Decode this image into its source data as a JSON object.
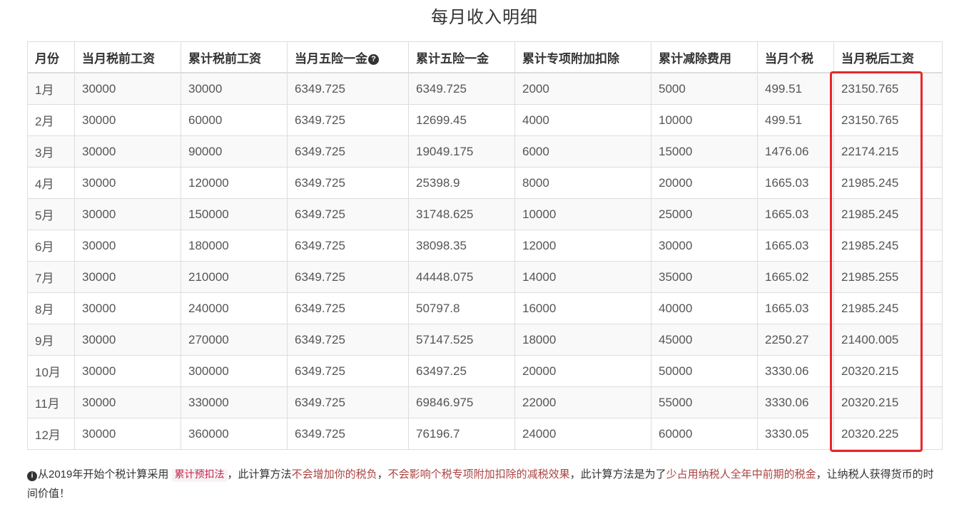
{
  "title": "每月收入明细",
  "table": {
    "headers": [
      "月份",
      "当月税前工资",
      "累计税前工资",
      "当月五险一金",
      "累计五险一金",
      "累计专项附加扣除",
      "累计减除费用",
      "当月个税",
      "当月税后工资"
    ],
    "rows": [
      [
        "1月",
        "30000",
        "30000",
        "6349.725",
        "6349.725",
        "2000",
        "5000",
        "499.51",
        "23150.765"
      ],
      [
        "2月",
        "30000",
        "60000",
        "6349.725",
        "12699.45",
        "4000",
        "10000",
        "499.51",
        "23150.765"
      ],
      [
        "3月",
        "30000",
        "90000",
        "6349.725",
        "19049.175",
        "6000",
        "15000",
        "1476.06",
        "22174.215"
      ],
      [
        "4月",
        "30000",
        "120000",
        "6349.725",
        "25398.9",
        "8000",
        "20000",
        "1665.03",
        "21985.245"
      ],
      [
        "5月",
        "30000",
        "150000",
        "6349.725",
        "31748.625",
        "10000",
        "25000",
        "1665.03",
        "21985.245"
      ],
      [
        "6月",
        "30000",
        "180000",
        "6349.725",
        "38098.35",
        "12000",
        "30000",
        "1665.03",
        "21985.245"
      ],
      [
        "7月",
        "30000",
        "210000",
        "6349.725",
        "44448.075",
        "14000",
        "35000",
        "1665.02",
        "21985.255"
      ],
      [
        "8月",
        "30000",
        "240000",
        "6349.725",
        "50797.8",
        "16000",
        "40000",
        "1665.03",
        "21985.245"
      ],
      [
        "9月",
        "30000",
        "270000",
        "6349.725",
        "57147.525",
        "18000",
        "45000",
        "2250.27",
        "21400.005"
      ],
      [
        "10月",
        "30000",
        "300000",
        "6349.725",
        "63497.25",
        "20000",
        "50000",
        "3330.06",
        "20320.215"
      ],
      [
        "11月",
        "30000",
        "330000",
        "6349.725",
        "69846.975",
        "22000",
        "55000",
        "3330.06",
        "20320.215"
      ],
      [
        "12月",
        "30000",
        "360000",
        "6349.725",
        "76196.7",
        "24000",
        "60000",
        "3330.05",
        "20320.225"
      ]
    ]
  },
  "icons": {
    "header_help": "question-circle-icon",
    "note_info": "info-circle-icon"
  },
  "note": {
    "part1": "从2019年开始个税计算采用",
    "method": "累计预扣法",
    "part2": "，此计算方法",
    "red1": "不会增加你的税负",
    "part3": "，",
    "red2": "不会影响个税专项附加扣除的减税效果",
    "part4": "，此计算方法是为了",
    "red3": "少占用纳税人全年中前期的税金",
    "part5": "，让纳税人获得货币的时间价值！"
  },
  "colors": {
    "highlight": "#e8262b",
    "note_red": "#a94442",
    "code_text": "#c7254e"
  }
}
